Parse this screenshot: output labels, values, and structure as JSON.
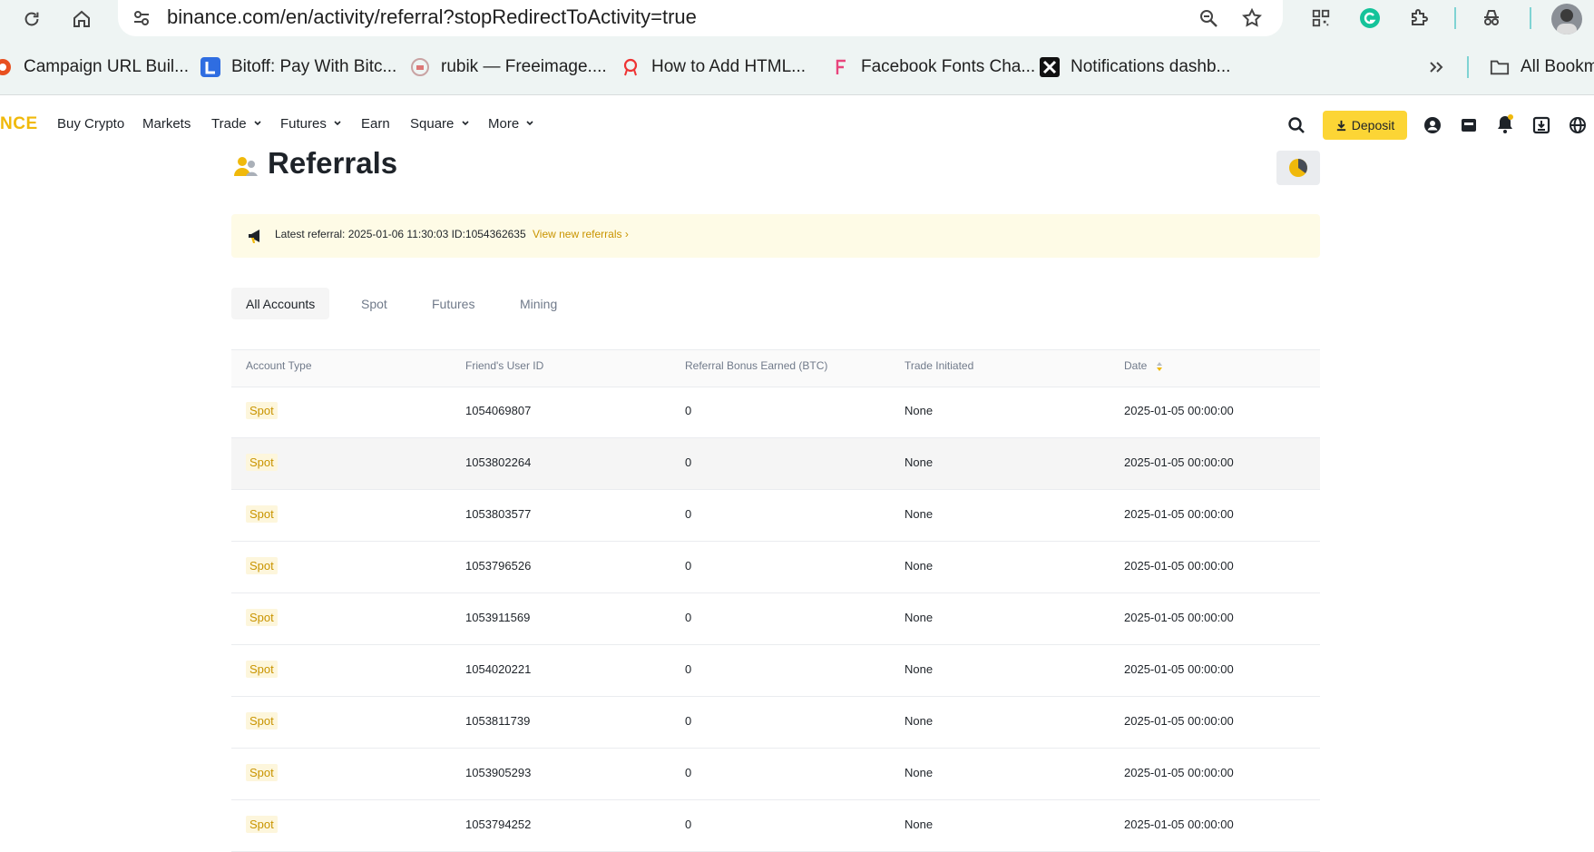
{
  "browser": {
    "url": "binance.com/en/activity/referral?stopRedirectToActivity=true",
    "bookmarks": [
      {
        "label": "Campaign URL Buil...",
        "icon": "campaign-favicon"
      },
      {
        "label": "Bitoff: Pay With Bitc...",
        "icon": "bitoff-favicon"
      },
      {
        "label": "rubik — Freeimage....",
        "icon": "rubik-favicon"
      },
      {
        "label": "How to Add HTML...",
        "icon": "html-favicon"
      },
      {
        "label": "Facebook Fonts Cha...",
        "icon": "facebook-fonts-favicon"
      },
      {
        "label": "Notifications dashb...",
        "icon": "notifications-favicon"
      }
    ],
    "all_bookmarks_label": "All Bookm"
  },
  "nav": {
    "logo": "NCE",
    "items": [
      "Buy Crypto",
      "Markets",
      "Trade",
      "Futures",
      "Earn",
      "Square",
      "More"
    ],
    "deposit_label": "Deposit",
    "brand_color": "#F0B90B"
  },
  "page": {
    "title": "Referrals",
    "banner": {
      "text": "Latest referral: 2025-01-06 11:30:03  ID:1054362635",
      "link": "View new referrals ›"
    },
    "tabs": [
      "All Accounts",
      "Spot",
      "Futures",
      "Mining"
    ],
    "active_tab": "All Accounts",
    "table": {
      "headers": [
        "Account Type",
        "Friend's User ID",
        "Referral Bonus Earned (BTC)",
        "Trade Initiated",
        "Date"
      ],
      "rows": [
        {
          "type": "Spot",
          "user_id": "1054069807",
          "bonus": "0",
          "trade": "None",
          "date": "2025-01-05 00:00:00"
        },
        {
          "type": "Spot",
          "user_id": "1053802264",
          "bonus": "0",
          "trade": "None",
          "date": "2025-01-05 00:00:00"
        },
        {
          "type": "Spot",
          "user_id": "1053803577",
          "bonus": "0",
          "trade": "None",
          "date": "2025-01-05 00:00:00"
        },
        {
          "type": "Spot",
          "user_id": "1053796526",
          "bonus": "0",
          "trade": "None",
          "date": "2025-01-05 00:00:00"
        },
        {
          "type": "Spot",
          "user_id": "1053911569",
          "bonus": "0",
          "trade": "None",
          "date": "2025-01-05 00:00:00"
        },
        {
          "type": "Spot",
          "user_id": "1054020221",
          "bonus": "0",
          "trade": "None",
          "date": "2025-01-05 00:00:00"
        },
        {
          "type": "Spot",
          "user_id": "1053811739",
          "bonus": "0",
          "trade": "None",
          "date": "2025-01-05 00:00:00"
        },
        {
          "type": "Spot",
          "user_id": "1053905293",
          "bonus": "0",
          "trade": "None",
          "date": "2025-01-05 00:00:00"
        },
        {
          "type": "Spot",
          "user_id": "1053794252",
          "bonus": "0",
          "trade": "None",
          "date": "2025-01-05 00:00:00"
        }
      ]
    }
  }
}
